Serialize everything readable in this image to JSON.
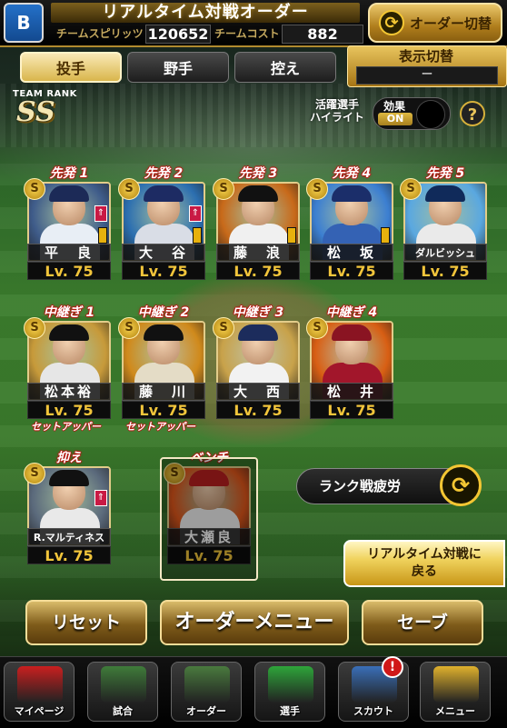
{
  "header": {
    "logo_text": "B",
    "title": "リアルタイム対戦オーダー",
    "team_spirit_label": "チームスピリッツ",
    "team_spirit_value": "120652",
    "team_cost_label": "チームコスト",
    "team_cost_value": "882",
    "order_switch_label": "オーダー切替"
  },
  "tabs": [
    {
      "label": "投手",
      "active": true
    },
    {
      "label": "野手",
      "active": false
    },
    {
      "label": "控え",
      "active": false
    }
  ],
  "display_switch": {
    "title": "表示切替",
    "value": "ー"
  },
  "team_rank": {
    "label": "TEAM RANK",
    "value": "SS"
  },
  "highlight": {
    "label_line1": "活躍選手",
    "label_line2": "ハイライト",
    "effect_title": "効果",
    "effect_state": "ON"
  },
  "help_label": "?",
  "starters": [
    {
      "slot": "先発 1",
      "name": "平　良",
      "level": "Lv. 75",
      "cap": "#1c2a57",
      "body": "#e8eef5",
      "bg": "#3f5c8a"
    },
    {
      "slot": "先発 2",
      "name": "大　谷",
      "level": "Lv. 75",
      "cap": "#1d2b63",
      "body": "#d9dde6",
      "bg": "#2c6fb0"
    },
    {
      "slot": "先発 3",
      "name": "藤　浪",
      "level": "Lv. 75",
      "cap": "#111",
      "body": "#f0f0f0",
      "bg": "#c86a1a"
    },
    {
      "slot": "先発 4",
      "name": "松　坂",
      "level": "Lv. 75",
      "cap": "#1b2e6a",
      "body": "#3462b4",
      "bg": "#3c7fd1"
    },
    {
      "slot": "先発 5",
      "name": "ダルビッシュ",
      "level": "Lv. 75",
      "cap": "#102a5a",
      "body": "#eaeaea",
      "bg": "#5aa8e0"
    }
  ],
  "relievers": [
    {
      "slot": "中継ぎ 1",
      "name": "松本裕",
      "level": "Lv. 75",
      "role": "セットアッパー",
      "cap": "#111",
      "body": "#e6e6e6",
      "bg": "#c79a3a"
    },
    {
      "slot": "中継ぎ 2",
      "name": "藤　川",
      "level": "Lv. 75",
      "role": "セットアッパー",
      "cap": "#111",
      "body": "#e4dcc6",
      "bg": "#d08a1c"
    },
    {
      "slot": "中継ぎ 3",
      "name": "大　西",
      "level": "Lv. 75",
      "role": "",
      "cap": "#1c2c5c",
      "body": "#f2f2f2",
      "bg": "#c8a24a"
    },
    {
      "slot": "中継ぎ 4",
      "name": "松　井",
      "level": "Lv. 75",
      "role": "",
      "cap": "#8a1422",
      "body": "#a2162b",
      "bg": "#d85f14"
    }
  ],
  "closer": {
    "slot": "抑え",
    "name": "R.マルティネス",
    "level": "Lv. 75",
    "cap": "#111",
    "body": "#e9e9e9",
    "bg": "#5b6a7c"
  },
  "bench": {
    "slot": "ベンチ",
    "name": "大瀬良",
    "level": "Lv. 75",
    "cap": "#b81f1f",
    "body": "#f1f1f1",
    "bg": "#e0571b"
  },
  "fatigue_label": "ランク戦疲労",
  "realtime_back": {
    "line1": "リアルタイム対戦に",
    "line2": "戻る"
  },
  "buttons": {
    "reset": "リセット",
    "order_menu": "オーダーメニュー",
    "save": "セーブ"
  },
  "nav": [
    {
      "label": "マイページ",
      "icon": "mypage-icon",
      "color": "#c91f1f"
    },
    {
      "label": "試合",
      "icon": "stadium-icon",
      "color": "#3f7b3a"
    },
    {
      "label": "オーダー",
      "icon": "order-icon",
      "color": "#4a7a3e"
    },
    {
      "label": "選手",
      "icon": "player-icon",
      "color": "#2ea53a"
    },
    {
      "label": "スカウト",
      "icon": "scout-icon",
      "color": "#3a6fb8"
    },
    {
      "label": "メニュー",
      "icon": "menu-icon",
      "color": "#e0b12d"
    }
  ],
  "notification_badge": "!",
  "s_badge": "S",
  "arrow_badge": "⇑",
  "cycle_glyph": "⟳"
}
